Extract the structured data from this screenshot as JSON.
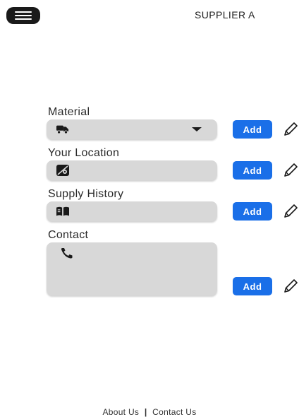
{
  "header": {
    "menu_icon": "hamburger-menu-icon",
    "supplier_name": "SUPPLIER A"
  },
  "form": {
    "fields": [
      {
        "label": "Material",
        "icon": "truck-icon",
        "has_dropdown": true,
        "add_label": "Add",
        "edit_icon": "pencil-icon"
      },
      {
        "label": "Your Location",
        "icon": "map-location-icon",
        "add_label": "Add",
        "edit_icon": "pencil-icon"
      },
      {
        "label": "Supply History",
        "icon": "book-icon",
        "add_label": "Add",
        "edit_icon": "pencil-icon"
      },
      {
        "label": "Contact",
        "icon": "phone-icon",
        "add_label": "Add",
        "edit_icon": "pencil-icon"
      }
    ]
  },
  "footer": {
    "about_label": "About Us",
    "separator": "|",
    "contact_label": "Contact Us"
  },
  "colors": {
    "accent": "#1a6fe8",
    "field_bg": "#d8d8d8",
    "menu_bg": "#1a1a1a"
  }
}
